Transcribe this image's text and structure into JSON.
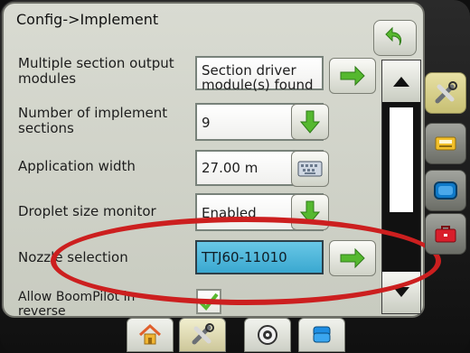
{
  "title": "Config->Implement",
  "rows": [
    {
      "label": "Multiple section output modules",
      "value": "Section driver module(s) found",
      "button_icon": "arrow-right-icon"
    },
    {
      "label": "Number of implement sections",
      "value": "9",
      "button_icon": "arrow-down-icon"
    },
    {
      "label": "Application width",
      "value": "27.00 m",
      "button_icon": "keyboard-icon"
    },
    {
      "label": "Droplet size monitor",
      "value": "Enabled",
      "button_icon": "arrow-down-icon"
    },
    {
      "label": "Nozzle selection",
      "value": "TTJ60-11010",
      "button_icon": "arrow-right-icon"
    },
    {
      "label": "Allow BoomPilot in reverse",
      "checked": true
    }
  ],
  "side_tabs": [
    "tools-icon",
    "console-icon",
    "display-icon",
    "toolbox-icon"
  ],
  "bottom_tabs": [
    "home-icon",
    "tools-icon",
    "gps-icon",
    "layers-icon"
  ],
  "colors": {
    "accent_green": "#55b82f",
    "selected_blue": "#49b6dc",
    "highlight_red": "#cc1f1f"
  }
}
